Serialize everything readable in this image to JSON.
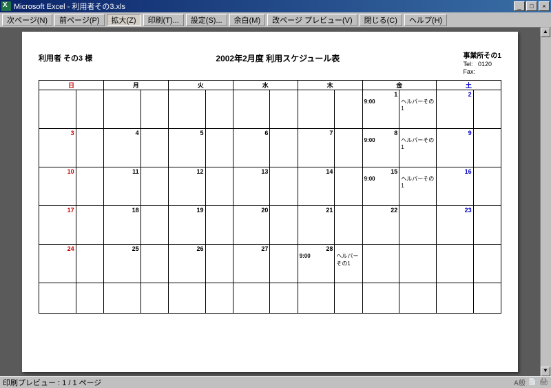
{
  "window": {
    "title": "Microsoft Excel - 利用者その3.xls"
  },
  "toolbar": {
    "next_page": "次ページ(N)",
    "prev_page": "前ページ(P)",
    "zoom": "拡大(Z)",
    "print": "印刷(T)...",
    "setup": "設定(S)...",
    "margins": "余白(M)",
    "page_break": "改ページ プレビュー(V)",
    "close": "閉じる(C)",
    "help": "ヘルプ(H)"
  },
  "sheet": {
    "user_label": "利用者 その3 様",
    "title": "2002年2月度  利用スケジュール表",
    "office_name": "事業所その1",
    "tel_label": "Tel:",
    "tel_value": "0120",
    "fax_label": "Fax:"
  },
  "weekdays": {
    "sun": "日",
    "mon": "月",
    "tue": "火",
    "wed": "水",
    "thu": "木",
    "fri": "金",
    "sat": "土"
  },
  "cal": {
    "w1": {
      "fri_num": "1",
      "fri_time": "9:00",
      "fri_text": "ヘルパーその1",
      "sat_num": "2"
    },
    "w2": {
      "sun": "3",
      "mon": "4",
      "tue": "5",
      "wed": "6",
      "thu": "7",
      "fri_num": "8",
      "fri_time": "9:00",
      "fri_text": "ヘルパーその1",
      "sat": "9"
    },
    "w3": {
      "sun": "10",
      "mon": "11",
      "tue": "12",
      "wed": "13",
      "thu": "14",
      "fri_num": "15",
      "fri_time": "9:00",
      "fri_text": "ヘルパーその1",
      "sat": "16"
    },
    "w4": {
      "sun": "17",
      "mon": "18",
      "tue": "19",
      "wed": "20",
      "thu": "21",
      "fri_num": "22",
      "sat": "23"
    },
    "w5": {
      "sun": "24",
      "mon": "25",
      "tue": "26",
      "wed": "27",
      "thu_num": "28",
      "thu_time": "9:00",
      "thu_text": "ヘルパーその1"
    }
  },
  "status": {
    "text": "印刷プレビュー : 1 / 1 ページ",
    "ime": "A般"
  }
}
